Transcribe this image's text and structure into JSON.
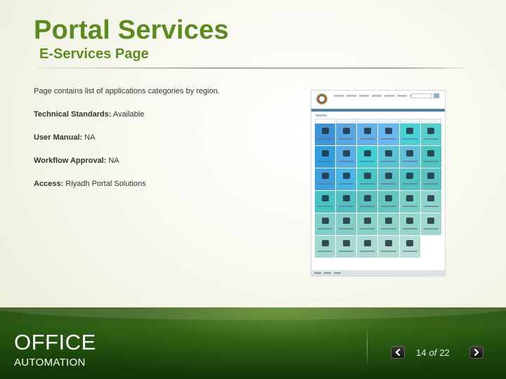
{
  "slide": {
    "title": "Portal Services",
    "subtitle": "E-Services Page",
    "description": "Page contains list of applications categories by region.",
    "fields": [
      {
        "label": "Technical Standards:",
        "value": "Available"
      },
      {
        "label": "User Manual:",
        "value": "NA"
      },
      {
        "label": "Workflow Approval:",
        "value": "NA"
      },
      {
        "label": "Access:",
        "value": "Riyadh Portal Solutions"
      }
    ]
  },
  "screenshot": {
    "tile_colors": [
      "#3f93d8",
      "#57a8e2",
      "#63b1e8",
      "#6ab8ef",
      "#4ad0d7",
      "#56cfcf",
      "#2f9fe0",
      "#58aee6",
      "#3fd0d6",
      "#5bc4d4",
      "#63c0da",
      "#4dc6c1",
      "#3fa0de",
      "#48b6e2",
      "#47c6c8",
      "#5dc0c6",
      "#4ec5c3",
      "#5ac3bf",
      "#47c4c4",
      "#52bfc3",
      "#5cc2bf",
      "#63c6c1",
      "#7ad0c4",
      "#8dd5cc",
      "#7fd0c8",
      "#84cfc5",
      "#89d4c9",
      "#8ed3c8",
      "#95d6ca",
      "#a0d8cd",
      "#9fd8cf",
      "#a6dad1",
      "#aadad2",
      "#b0dcd4",
      "#b6dfd7",
      "blank"
    ]
  },
  "footer": {
    "brand": "OFFICE",
    "brand_sub": "AUTOMATION",
    "page_current": "14",
    "page_of": "of",
    "page_total": "22",
    "prev_icon": "chevron-left-icon",
    "next_icon": "chevron-right-icon"
  }
}
